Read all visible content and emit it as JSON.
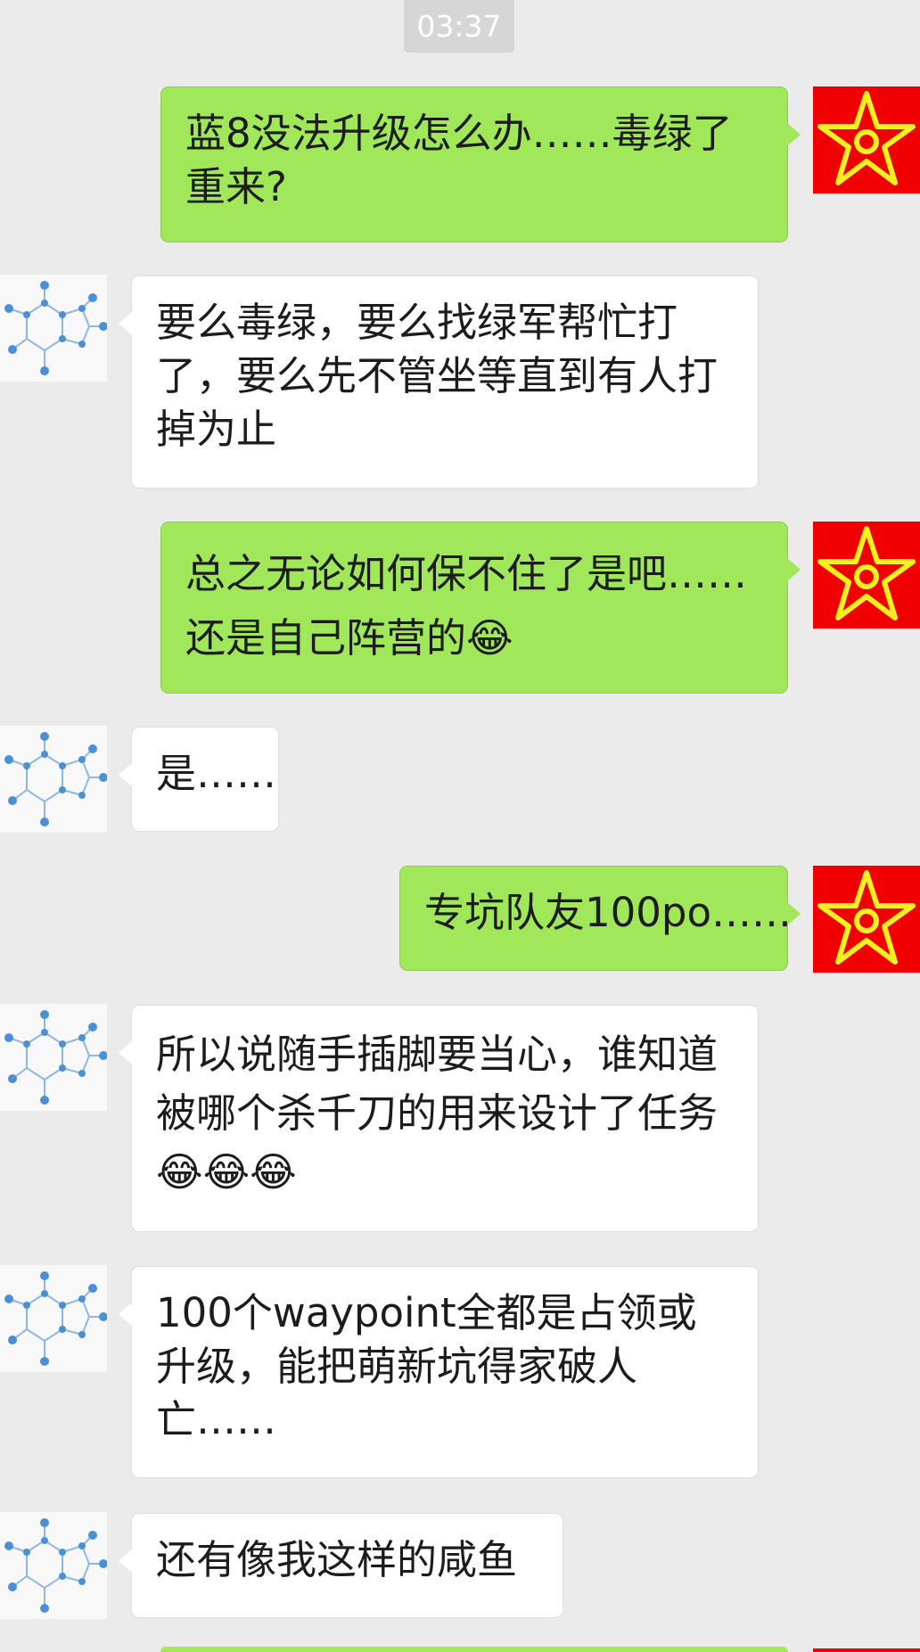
{
  "timestamp": "03:37",
  "messages": [
    {
      "side": "out",
      "text": "蓝8没法升级怎么办……毒绿了重来?"
    },
    {
      "side": "in",
      "text": "要么毒绿，要么找绿军帮忙打了，要么先不管坐等直到有人打掉为止"
    },
    {
      "side": "out",
      "text": "总之无论如何保不住了是吧……还是自己阵营的😂"
    },
    {
      "side": "in",
      "text": "是……"
    },
    {
      "side": "out",
      "text": "专坑队友100po……"
    },
    {
      "side": "in",
      "text": "所以说随手插脚要当心，谁知道被哪个杀千刀的用来设计了任务😂😂😂"
    },
    {
      "side": "in",
      "text": "100个waypoint全都是占领或升级，能把萌新坑得家破人亡……"
    },
    {
      "side": "in",
      "text": "还有像我这样的咸鱼"
    }
  ],
  "avatars": {
    "self": {
      "icon": "yellow-star-icon",
      "background": "#f00000",
      "color": "#f5f01e"
    },
    "peer": {
      "icon": "molecule-icon",
      "background": "#f8f8f8",
      "color": "#4a90d9"
    }
  },
  "colors": {
    "background": "#ebebeb",
    "outgoing_bubble": "#a0e75a",
    "incoming_bubble": "#ffffff",
    "timestamp_pill": "#d6d6d6"
  }
}
